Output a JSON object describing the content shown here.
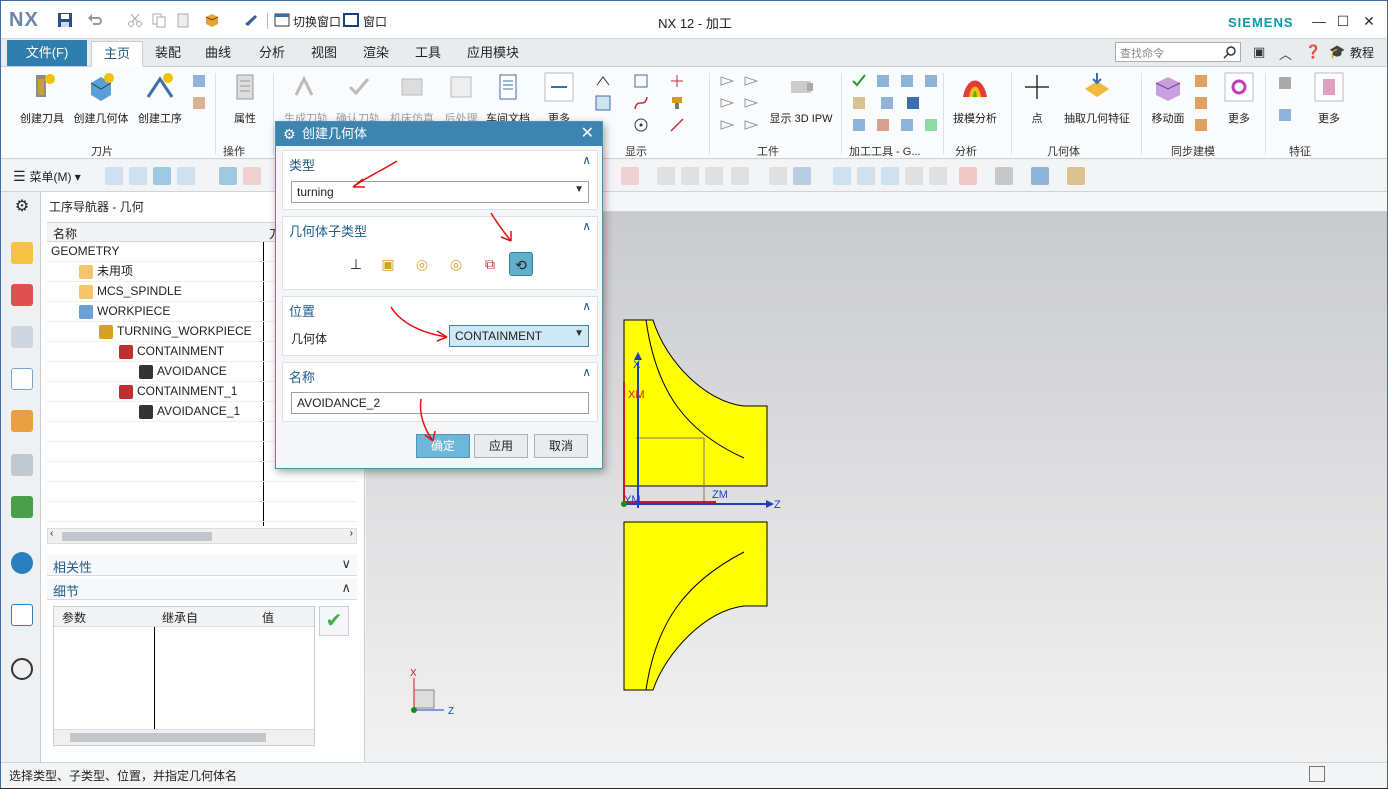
{
  "app": {
    "logo": "NX",
    "title": "NX 12 - 加工",
    "brand": "SIEMENS",
    "quick_access": {
      "switch_window": "切换窗口",
      "window": "窗口"
    }
  },
  "tabs": {
    "file": "文件(F)",
    "items": [
      "主页",
      "装配",
      "曲线",
      "分析",
      "视图",
      "渲染",
      "工具",
      "应用模块"
    ],
    "active": "主页"
  },
  "search": {
    "placeholder": "查找命令"
  },
  "help": {
    "tutorial": "教程"
  },
  "ribbon": {
    "groups": {
      "insert": {
        "label": "刀片",
        "buttons": [
          "创建刀具",
          "创建几何体",
          "创建工序"
        ]
      },
      "operations": {
        "label": "操作",
        "buttons": [
          "属性"
        ]
      },
      "toolpath": {
        "buttons": [
          "生成刀轨",
          "确认刀轨",
          "机床仿真",
          "后处理",
          "车间文档",
          "更多"
        ]
      },
      "display": {
        "label": "显示"
      },
      "workpiece": {
        "label": "工件",
        "buttons": [
          "显示 3D IPW"
        ]
      },
      "machining_tools": {
        "label": "加工工具 - G..."
      },
      "analysis": {
        "label": "分析",
        "buttons": [
          "拔模分析"
        ]
      },
      "geometry": {
        "label": "几何体",
        "buttons": [
          "点",
          "抽取几何特征"
        ]
      },
      "sync": {
        "label": "同步建模",
        "buttons": [
          "移动面",
          "更多"
        ]
      },
      "feature": {
        "label": "特征",
        "buttons": [
          "更多"
        ]
      }
    }
  },
  "toolbar2": {
    "menu": "菜单(M)"
  },
  "navigator": {
    "title": "工序导航器 - 几何",
    "column_name": "名称",
    "column_second": "刀",
    "tree": [
      {
        "label": "GEOMETRY",
        "level": 0
      },
      {
        "label": "未用项",
        "level": 1
      },
      {
        "label": "MCS_SPINDLE",
        "level": 1
      },
      {
        "label": "WORKPIECE",
        "level": 2
      },
      {
        "label": "TURNING_WORKPIECE",
        "level": 3
      },
      {
        "label": "CONTAINMENT",
        "level": 4
      },
      {
        "label": "AVOIDANCE",
        "level": 5
      },
      {
        "label": "CONTAINMENT_1",
        "level": 4
      },
      {
        "label": "AVOIDANCE_1",
        "level": 5
      }
    ],
    "dependencies": "相关性",
    "details": "细节",
    "details_columns": [
      "参数",
      "继承自",
      "值"
    ]
  },
  "dialog": {
    "title": "创建几何体",
    "type_section": "类型",
    "type_value": "turning",
    "subtype_section": "几何体子类型",
    "position_section": "位置",
    "geometry_label": "几何体",
    "geometry_value": "CONTAINMENT",
    "name_section": "名称",
    "name_value": "AVOIDANCE_2",
    "ok": "确定",
    "apply": "应用",
    "cancel": "取消"
  },
  "viewport": {
    "axes": {
      "x": "X",
      "xm": "XM",
      "ym": "YM",
      "zm": "ZM",
      "z": "Z"
    },
    "triad": {
      "x": "X",
      "z": "Z"
    }
  },
  "status": {
    "text": "选择类型、子类型、位置，并指定几何体名"
  },
  "colors": {
    "accent": "#3c85b0",
    "part": "#ffff00",
    "annotation": "#e01010"
  }
}
